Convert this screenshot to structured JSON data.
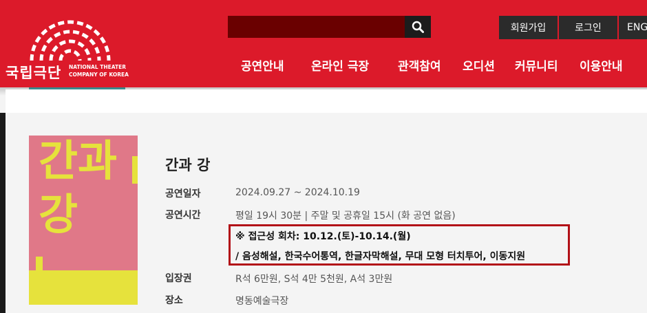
{
  "header": {
    "logo": {
      "ko": "국립극단",
      "en_line1": "NATIONAL THEATER",
      "en_line2": "COMPANY OF KOREA"
    },
    "search": {
      "placeholder": "",
      "icon": "search-icon"
    },
    "utility": {
      "signup": "회원가입",
      "login": "로그인",
      "lang": "ENG"
    },
    "nav": [
      "공연안내",
      "온라인 극장",
      "관객참여",
      "오디션",
      "커뮤니티",
      "이용안내"
    ],
    "colors": {
      "brand_red": "#dc1a2a",
      "search_bg": "#6a0000",
      "util_bg": "#2b2b2b"
    }
  },
  "poster": {
    "text_line1": "간과",
    "text_line2": "강"
  },
  "show": {
    "title": "간과 강",
    "date_label": "공연일자",
    "date_value": "2024.09.27 ~ 2024.10.19",
    "time_label": "공연시간",
    "time_value": "평일 19시 30분 | 주말 및 공휴일 15시 (화 공연 없음)",
    "access_line1": "※ 접근성 회차: 10.12.(토)-10.14.(월)",
    "access_line2": "/ 음성해설, 한국수어통역, 한글자막해설, 무대 모형 터치투어, 이동지원",
    "ticket_label": "입장권",
    "ticket_value": "R석 6만원, S석 4만 5천원, A석 3만원",
    "venue_label": "장소",
    "venue_value": "명동예술극장"
  }
}
